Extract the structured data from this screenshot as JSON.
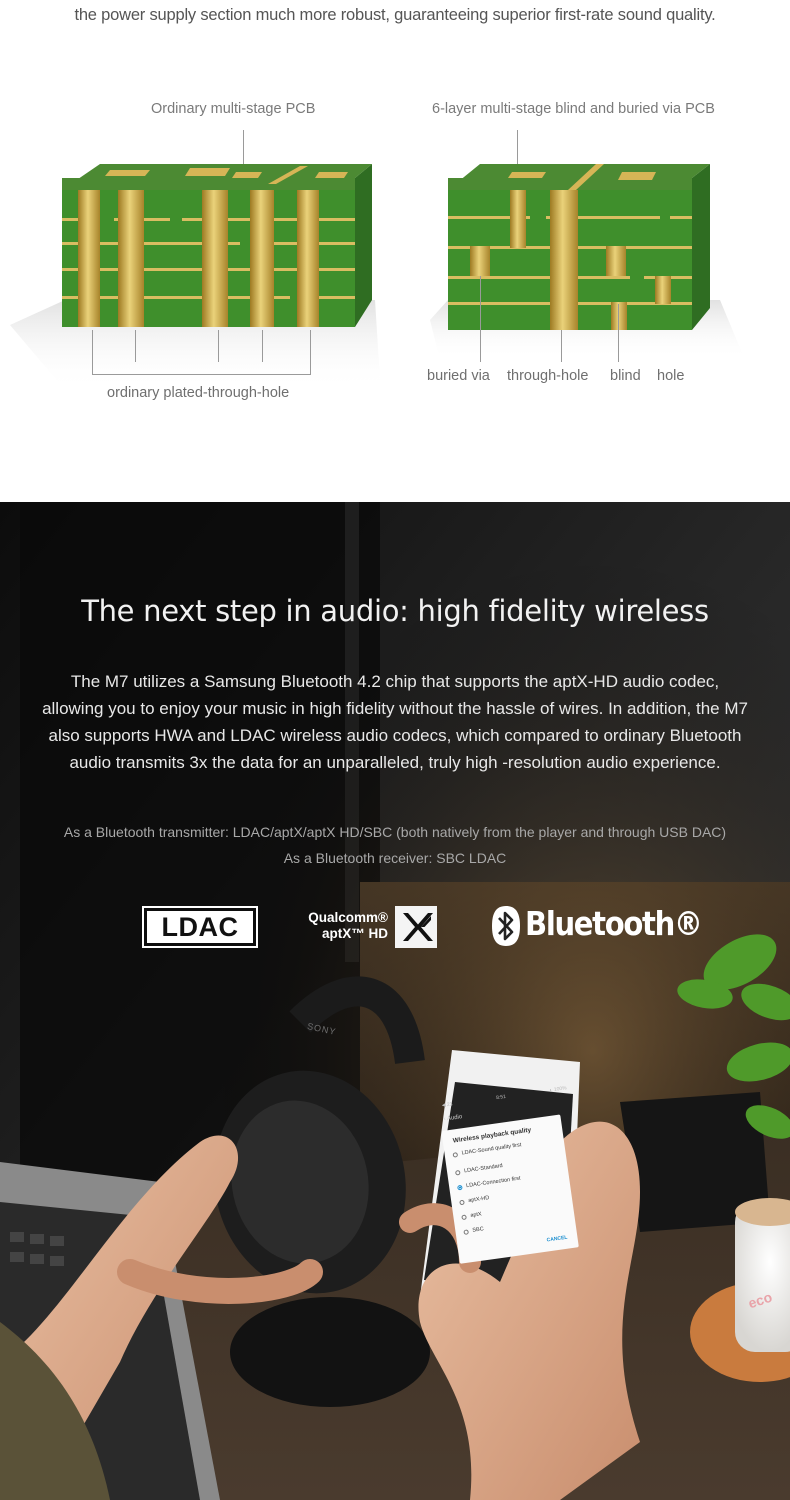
{
  "intro": {
    "text": "the power supply section much more robust, guaranteeing superior first-rate sound quality."
  },
  "pcb": {
    "left_caption": "Ordinary multi-stage PCB",
    "right_caption": "6-layer multi-stage blind and buried via PCB",
    "left_bottom_label": "ordinary plated-through-hole",
    "right_labels": [
      "buried via",
      "through-hole",
      "blind",
      "hole"
    ],
    "colors": {
      "board": "#3f8f2c",
      "board_dark": "#2f6d22",
      "gold": "#c9a23a",
      "gold_light": "#ead27a"
    }
  },
  "wireless": {
    "title": "The next step in audio: high fidelity wireless",
    "body": "The M7 utilizes a Samsung Bluetooth 4.2 chip that supports the aptX-HD audio codec, allowing you to enjoy your music in high fidelity without the hassle of wires. In addition, the M7 also supports HWA and LDAC wireless audio codecs, which compared to ordinary Bluetooth audio transmits 3x the data for an unparalleled, truly high -resolution audio experience.",
    "transmitter": "As a Bluetooth transmitter: LDAC/aptX/aptX HD/SBC (both natively from the player and through USB DAC)",
    "receiver": "As a Bluetooth receiver: SBC  LDAC"
  },
  "logos": {
    "ldac": "LDAC",
    "qualcomm_line1": "Qualcomm®",
    "qualcomm_line2": "aptX™ HD",
    "bluetooth": "Bluetooth®",
    "icons": [
      "ldac-logo",
      "qualcomm-aptx-hd-logo",
      "bluetooth-icon"
    ]
  },
  "phone": {
    "status_left": "◀ 23",
    "status_mid": "8:51",
    "status_right": "◐ 100%",
    "header": "‹  Audio",
    "dialog_title": "Wireless playback quality",
    "options": [
      {
        "label": "LDAC-Sound quality first",
        "selected": false
      },
      {
        "label": "LDAC-Standard",
        "selected": false
      },
      {
        "label": "LDAC-Connection first",
        "selected": true
      },
      {
        "label": "aptX-HD",
        "selected": false
      },
      {
        "label": "aptX",
        "selected": false
      },
      {
        "label": "SBC",
        "selected": false
      }
    ],
    "cancel": "CANCEL"
  },
  "photo_marks": {
    "headphone_brand": "SONY",
    "cup_text": "eco"
  }
}
